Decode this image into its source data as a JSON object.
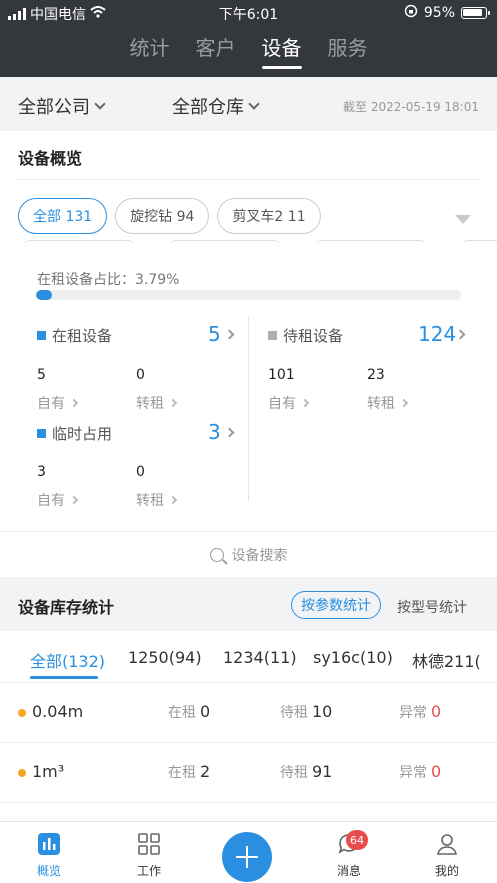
{
  "status_bar": {
    "carrier": "中国电信",
    "time": "下午6:01",
    "battery": "95%"
  },
  "top_tabs": [
    {
      "label": "统计",
      "active": false
    },
    {
      "label": "客户",
      "active": false
    },
    {
      "label": "设备",
      "active": true
    },
    {
      "label": "服务",
      "active": false
    }
  ],
  "filters": {
    "company": "全部公司",
    "warehouse": "全部仓库",
    "as_of": "截至 2022-05-19 18:01"
  },
  "overview": {
    "title": "设备概览",
    "chips": [
      "全部 131",
      "旋挖钻 94",
      "剪叉车2 11"
    ],
    "ratio_label": "在租设备占比：3.79%",
    "ratio_percent": 3.79,
    "rented": {
      "label": "在租设备",
      "value": "5",
      "own_value": "5",
      "own_label": "自有",
      "sublet_value": "0",
      "sublet_label": "转租"
    },
    "idle": {
      "label": "待租设备",
      "value": "124",
      "own_value": "101",
      "own_label": "自有",
      "sublet_value": "23",
      "sublet_label": "转租"
    },
    "temp": {
      "label": "临时占用",
      "value": "3",
      "own_value": "3",
      "own_label": "自有",
      "sublet_value": "0",
      "sublet_label": "转租"
    },
    "search_label": "设备搜索"
  },
  "inventory": {
    "title": "设备库存统计",
    "btn_param": "按参数统计",
    "btn_model": "按型号统计",
    "tabs": [
      "全部(132)",
      "1250(94)",
      "1234(11)",
      "sy16c(10)",
      "林德211("
    ],
    "rows": [
      {
        "name": "0.04m",
        "rent_label": "在租",
        "rent": "0",
        "idle_label": "待租",
        "idle": "10",
        "abn_label": "异常",
        "abn": "0"
      },
      {
        "name": "1m³",
        "rent_label": "在租",
        "rent": "2",
        "idle_label": "待租",
        "idle": "91",
        "abn_label": "异常",
        "abn": "0"
      }
    ]
  },
  "bottom_nav": {
    "overview": "概览",
    "work": "工作",
    "messages": "消息",
    "messages_badge": "64",
    "mine": "我的"
  },
  "colors": {
    "accent": "#2a8fe0",
    "warning_dot": "#f5a623",
    "danger": "#e94c4c",
    "header_bg": "#34373c"
  }
}
